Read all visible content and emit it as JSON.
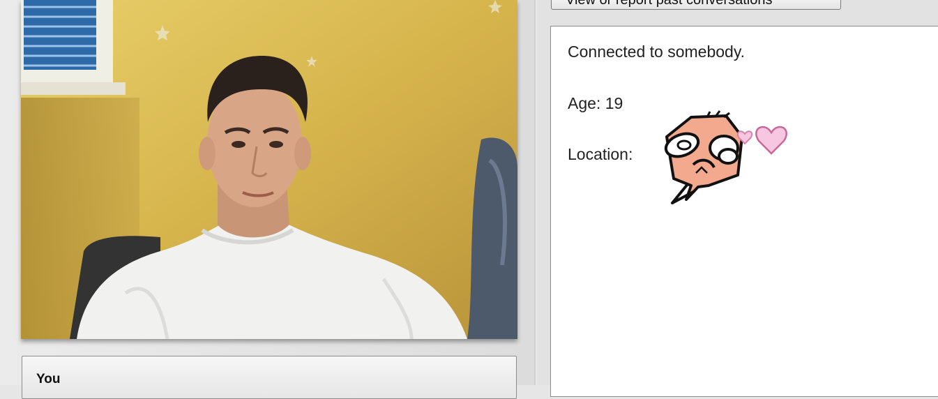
{
  "self_panel": {
    "label": "You"
  },
  "toolbar": {
    "past_conversations_label": "View or report past conversations"
  },
  "chat": {
    "status_message": "Connected to somebody.",
    "age_line": "Age: 19",
    "location_line": "Location:"
  },
  "colors": {
    "page_background": "#e2e2e2",
    "chat_background": "#ffffff",
    "panel_border": "#8a8a8a",
    "sticker_skin": "#f2a98e",
    "sticker_heart": "#f7c6e0"
  },
  "icons": {
    "webcam_feed": "webcam-video",
    "sticker": "rage-face-sticker",
    "hearts": "heart-icon"
  }
}
